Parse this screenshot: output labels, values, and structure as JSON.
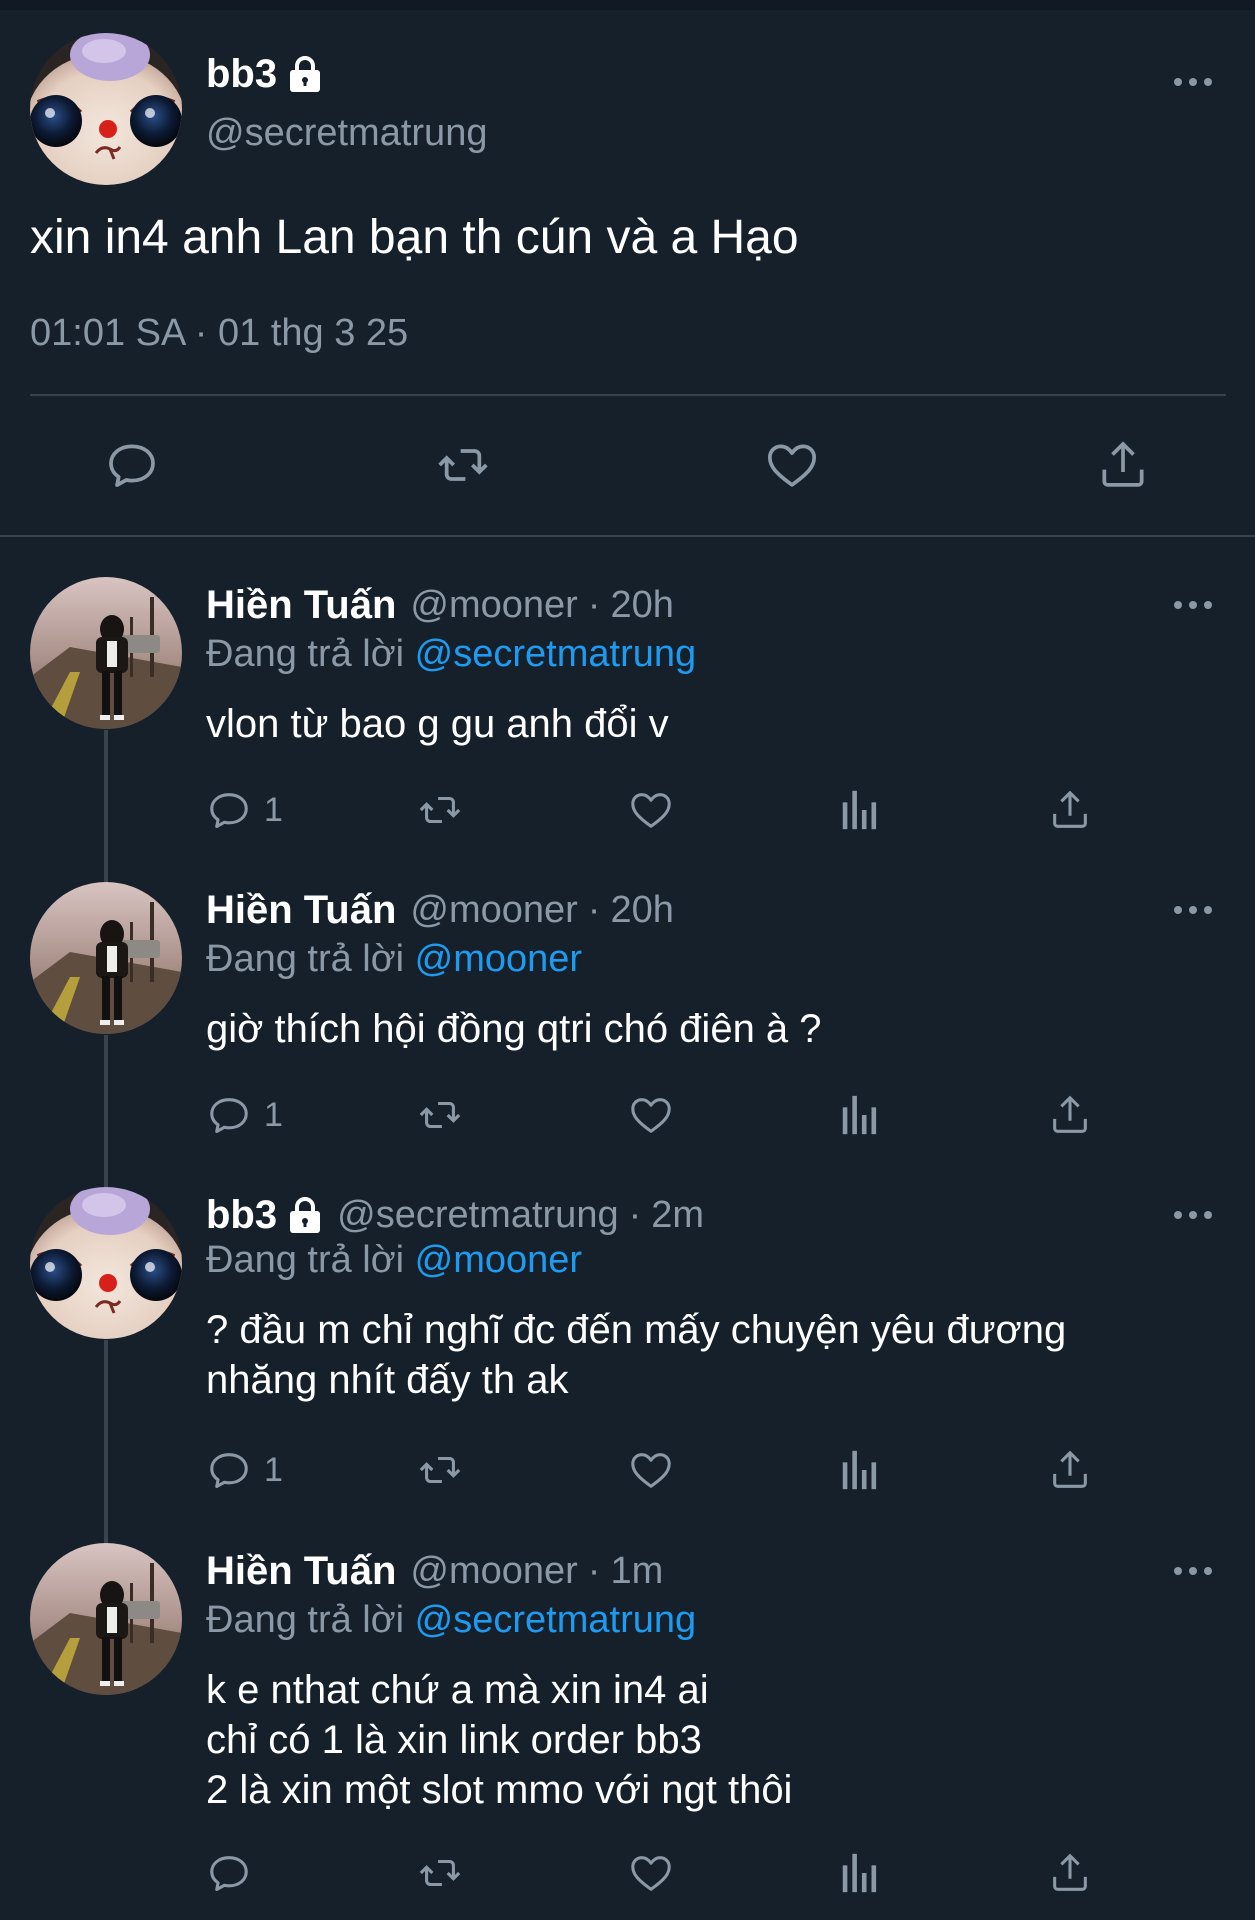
{
  "main_tweet": {
    "display_name": "bb3",
    "handle": "@secretmatrung",
    "text": "xin in4 anh Lan bạn th cún và a Hạo",
    "timestamp": "01:01 SA · 01 thg 3 25",
    "actions": [
      "reply-icon",
      "retweet-icon",
      "like-icon",
      "share-icon"
    ]
  },
  "replies": [
    {
      "display_name": "Hiền Tuấn",
      "handle": "@mooner",
      "separator": "·",
      "time": "20h",
      "replying_prefix": "Đang trả lời",
      "replying_to": "@secretmatrung",
      "text": "vlon từ bao g gu anh đổi v",
      "reply_count": "1"
    },
    {
      "display_name": "Hiền Tuấn",
      "handle": "@mooner",
      "separator": "·",
      "time": "20h",
      "replying_prefix": "Đang trả lời",
      "replying_to": "@mooner",
      "text": "giờ thích hội đồng qtri chó điên à ?",
      "reply_count": "1"
    },
    {
      "display_name": "bb3",
      "handle": "@secretmatrung",
      "separator": "·",
      "time": "2m",
      "replying_prefix": "Đang trả lời",
      "replying_to": "@mooner",
      "text": "? đầu m chỉ nghĩ đc đến mấy chuyện yêu đương\nnhăng nhít đấy th ak",
      "reply_count": "1",
      "locked": true
    },
    {
      "display_name": "Hiền Tuấn",
      "handle": "@mooner",
      "separator": "·",
      "time": "1m",
      "replying_prefix": "Đang trả lời",
      "replying_to": "@secretmatrung",
      "text": "k e nthat chứ a mà xin in4 ai\nchỉ có 1 là xin link order bb3\n2 là xin một slot mmo với ngt thôi",
      "reply_count": ""
    }
  ],
  "colors": {
    "background": "#15202b",
    "secondary_text": "#8b98a5",
    "mention": "#1d9bf0",
    "divider": "#38444d"
  }
}
